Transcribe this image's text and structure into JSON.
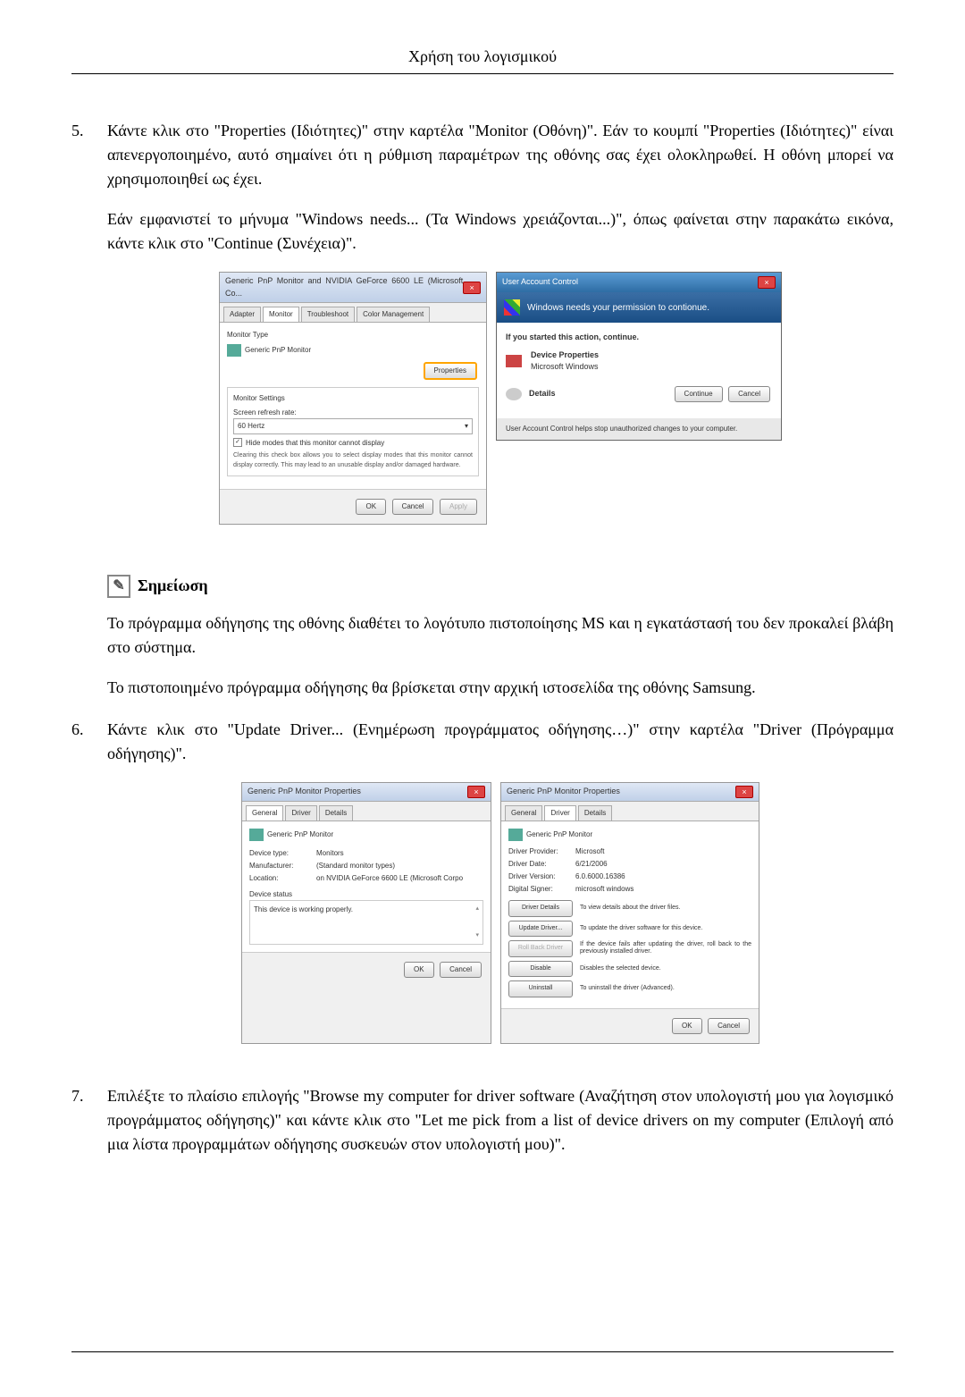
{
  "header": "Χρήση του λογισμικού",
  "step5": {
    "number": "5.",
    "para1": "Κάντε κλικ στο \"Properties (Ιδιότητες)\" στην καρτέλα \"Monitor (Οθόνη)\". Εάν το κουμπί \"Properties (Ιδιότητες)\" είναι απενεργοποιημένο, αυτό σημαίνει ότι η ρύθμιση παραμέτρων της οθόνης σας έχει ολοκληρωθεί. Η οθόνη μπορεί να χρησιμοποιηθεί ως έχει.",
    "para2": "Εάν εμφανιστεί το μήνυμα \"Windows needs... (Τα Windows χρειάζονται...)\", όπως φαίνεται στην παρακάτω εικόνα, κάντε κλικ στο \"Continue (Συνέχεια)\"."
  },
  "monitor_dialog": {
    "title": "Generic PnP Monitor and NVIDIA GeForce 6600 LE (Microsoft Co...",
    "tabs": [
      "Adapter",
      "Monitor",
      "Troubleshoot",
      "Color Management"
    ],
    "monitor_type_label": "Monitor Type",
    "monitor_name": "Generic PnP Monitor",
    "properties_btn": "Properties",
    "settings_label": "Monitor Settings",
    "refresh_label": "Screen refresh rate:",
    "refresh_value": "60 Hertz",
    "hide_label": "Hide modes that this monitor cannot display",
    "hide_desc": "Clearing this check box allows you to select display modes that this monitor cannot display correctly. This may lead to an unusable display and/or damaged hardware.",
    "ok": "OK",
    "cancel": "Cancel",
    "apply": "Apply"
  },
  "uac": {
    "title": "User Account Control",
    "banner": "Windows needs your permission to contionue.",
    "started": "If you started this action, continue.",
    "prog_name": "Device Properties",
    "publisher": "Microsoft Windows",
    "details": "Details",
    "continue": "Continue",
    "cancel": "Cancel",
    "footer": "User Account Control helps stop unauthorized changes to your computer."
  },
  "note": {
    "title": "Σημείωση",
    "para1": "Το πρόγραμμα οδήγησης της οθόνης διαθέτει το λογότυπο πιστοποίησης MS και η εγκατάστασή του δεν προκαλεί βλάβη στο σύστημα.",
    "para2": "Το πιστοποιημένο πρόγραμμα οδήγησης θα βρίσκεται στην αρχική ιστοσελίδα της οθόνης Samsung."
  },
  "step6": {
    "number": "6.",
    "para1": "Κάντε κλικ στο \"Update Driver... (Ενημέρωση προγράμματος οδήγησης…)\" στην καρτέλα \"Driver (Πρόγραμμα οδήγησης)\"."
  },
  "props_general": {
    "title": "Generic PnP Monitor Properties",
    "tabs": [
      "General",
      "Driver",
      "Details"
    ],
    "name": "Generic PnP Monitor",
    "device_type_label": "Device type:",
    "device_type": "Monitors",
    "manufacturer_label": "Manufacturer:",
    "manufacturer": "(Standard monitor types)",
    "location_label": "Location:",
    "location": "on NVIDIA GeForce 6600 LE (Microsoft Corpo",
    "status_label": "Device status",
    "status_text": "This device is working properly.",
    "ok": "OK",
    "cancel": "Cancel"
  },
  "props_driver": {
    "title": "Generic PnP Monitor Properties",
    "tabs": [
      "General",
      "Driver",
      "Details"
    ],
    "name": "Generic PnP Monitor",
    "provider_label": "Driver Provider:",
    "provider": "Microsoft",
    "date_label": "Driver Date:",
    "date": "6/21/2006",
    "version_label": "Driver Version:",
    "version": "6.0.6000.16386",
    "signer_label": "Digital Signer:",
    "signer": "microsoft windows",
    "details_btn": "Driver Details",
    "details_desc": "To view details about the driver files.",
    "update_btn": "Update Driver...",
    "update_desc": "To update the driver software for this device.",
    "rollback_btn": "Roll Back Driver",
    "rollback_desc": "If the device fails after updating the driver, roll back to the previously installed driver.",
    "disable_btn": "Disable",
    "disable_desc": "Disables the selected device.",
    "uninstall_btn": "Uninstall",
    "uninstall_desc": "To uninstall the driver (Advanced).",
    "ok": "OK",
    "cancel": "Cancel"
  },
  "step7": {
    "number": "7.",
    "para1": "Επιλέξτε το πλαίσιο επιλογής \"Browse my computer for driver software (Αναζήτηση στον υπολογιστή μου για λογισμικό προγράμματος οδήγησης)\" και κάντε κλικ στο \"Let me pick from a list of device drivers on my computer (Επιλογή από μια λίστα προγραμμάτων οδήγησης συσκευών στον υπολογιστή μου)\"."
  }
}
